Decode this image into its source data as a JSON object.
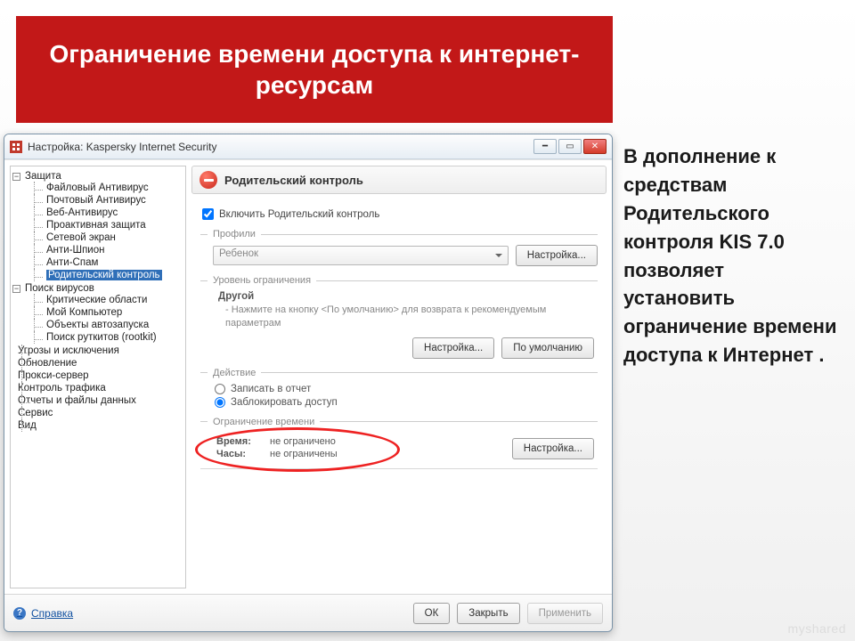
{
  "slide": {
    "title": "Ограничение времени доступа к интернет-ресурсам",
    "side_text": "В дополнение к средствам Родительского контроля  KIS 7.0 позволяет установить ограничение времени доступа к Интернет .",
    "watermark": "myshared"
  },
  "window": {
    "title": "Настройка: Kaspersky Internet Security",
    "min_tip": "Свернуть",
    "max_tip": "Развернуть",
    "close_tip": "Закрыть"
  },
  "tree": {
    "root1": "Защита",
    "children1": [
      "Файловый Антивирус",
      "Почтовый Антивирус",
      "Веб-Антивирус",
      "Проактивная защита",
      "Сетевой экран",
      "Анти-Шпион",
      "Анти-Спам",
      "Родительский контроль"
    ],
    "root2": "Поиск вирусов",
    "children2": [
      "Критические области",
      "Мой Компьютер",
      "Объекты автозапуска",
      "Поиск руткитов (rootkit)"
    ],
    "flat": [
      "Угрозы и исключения",
      "Обновление",
      "Прокси-сервер",
      "Контроль трафика",
      "Отчеты и файлы данных",
      "Сервис",
      "Вид"
    ]
  },
  "pane": {
    "header": "Родительский контроль",
    "enable": "Включить Родительский контроль",
    "grp_profiles": "Профили",
    "profile_value": "Ребенок",
    "btn_settings": "Настройка...",
    "grp_level": "Уровень ограничения",
    "level_name": "Другой",
    "level_hint": "- Нажмите на кнопку <По умолчанию> для возврата к рекомендуемым параметрам",
    "btn_settings2": "Настройка...",
    "btn_default": "По умолчанию",
    "grp_action": "Действие",
    "radio_log": "Записать в отчет",
    "radio_block": "Заблокировать доступ",
    "grp_time": "Ограничение времени",
    "time_label": "Время:",
    "time_value": "не ограничено",
    "hours_label": "Часы:",
    "hours_value": "не ограничены",
    "btn_settings3": "Настройка..."
  },
  "footer": {
    "help": "Справка",
    "ok": "ОК",
    "close": "Закрыть",
    "apply": "Применить"
  }
}
